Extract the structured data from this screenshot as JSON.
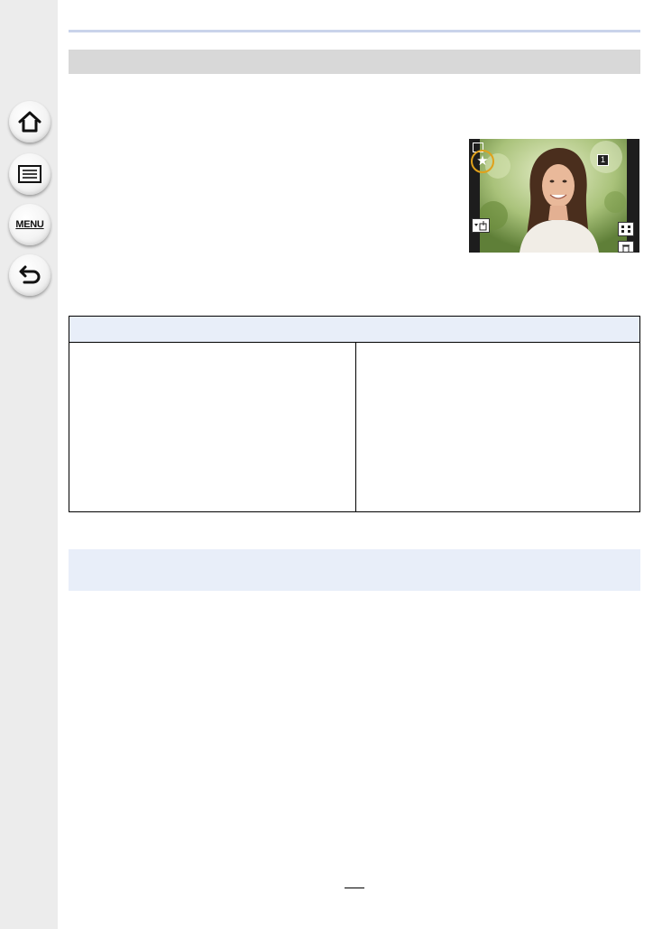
{
  "sidebar": {
    "buttons": [
      {
        "name": "home",
        "icon": "home-icon"
      },
      {
        "name": "contents",
        "icon": "list-icon"
      },
      {
        "name": "menu",
        "icon": "menu-icon",
        "label": "MENU"
      },
      {
        "name": "back",
        "icon": "back-arrow-icon"
      }
    ]
  },
  "photo": {
    "frame_number": "1",
    "icons": [
      "favorite-star-icon",
      "grid-icon",
      "delete-icon",
      "send-icon",
      "playback-icon"
    ],
    "highlight_color": "#e0a11b"
  },
  "page": {
    "number": ""
  },
  "colors": {
    "accent_rule": "#c9d3ea",
    "section_bar": "#d8d8d8",
    "table_header": "#e8eef9"
  }
}
